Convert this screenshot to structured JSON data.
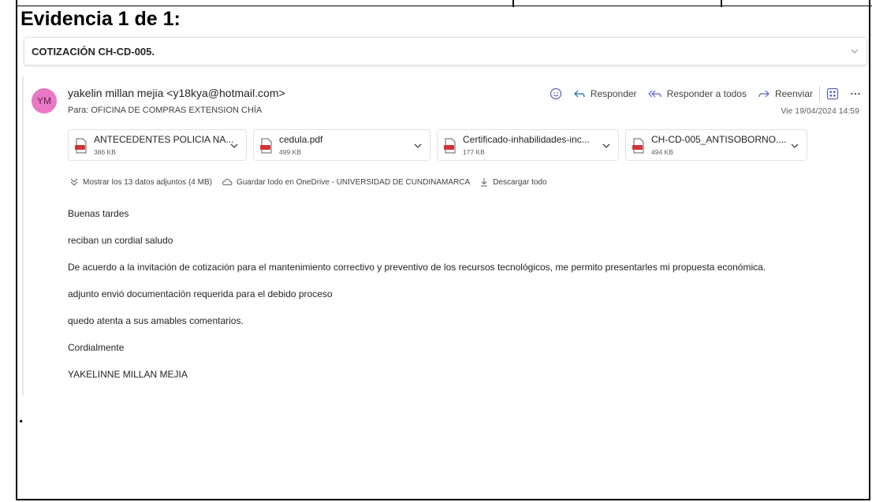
{
  "document": {
    "heading": "Evidencia 1 de 1:",
    "footer_mark": "."
  },
  "email": {
    "subject": "COTIZACIÓN CH-CD-005.",
    "avatar_initials": "YM",
    "avatar_color": "#e979c4",
    "sender": "yakelin millan mejia <y18kya@hotmail.com>",
    "to": "Para:  OFICINA DE COMPRAS EXTENSION CHÍA",
    "date": "Vie 19/04/2024 14:59",
    "actions": {
      "reply": "Responder",
      "reply_all": "Responder a todos",
      "forward": "Reenviar"
    },
    "attachments": [
      {
        "name": "ANTECEDENTES POLICIA NA...",
        "size": "386 KB"
      },
      {
        "name": "cedula.pdf",
        "size": "499 KB"
      },
      {
        "name": "Certificado-inhabilidades-inc...",
        "size": "177 KB"
      },
      {
        "name": "CH-CD-005_ANTISOBORNO....",
        "size": "494 KB"
      }
    ],
    "attachment_links": {
      "show_all": "Mostrar los 13 datos adjuntos (4 MB)",
      "save_onedrive": "Guardar todo en OneDrive - UNIVERSIDAD DE CUNDINAMARCA",
      "download_all": "Descargar todo"
    },
    "body": [
      "Buenas tardes",
      "reciban un cordial saludo",
      "De acuerdo a la invitación de cotización para el mantenimiento correctivo y preventivo de los recursos tecnológicos, me permito presentarles mi propuesta económica.",
      "adjunto envió documentación requerida para el debido proceso",
      "quedo atenta a sus amables comentarios.",
      "Cordialmente",
      "YAKELINNE MILLAN MEJIA"
    ]
  },
  "colors": {
    "accent": "#0f6cbd",
    "pdf_red": "#d13438"
  }
}
